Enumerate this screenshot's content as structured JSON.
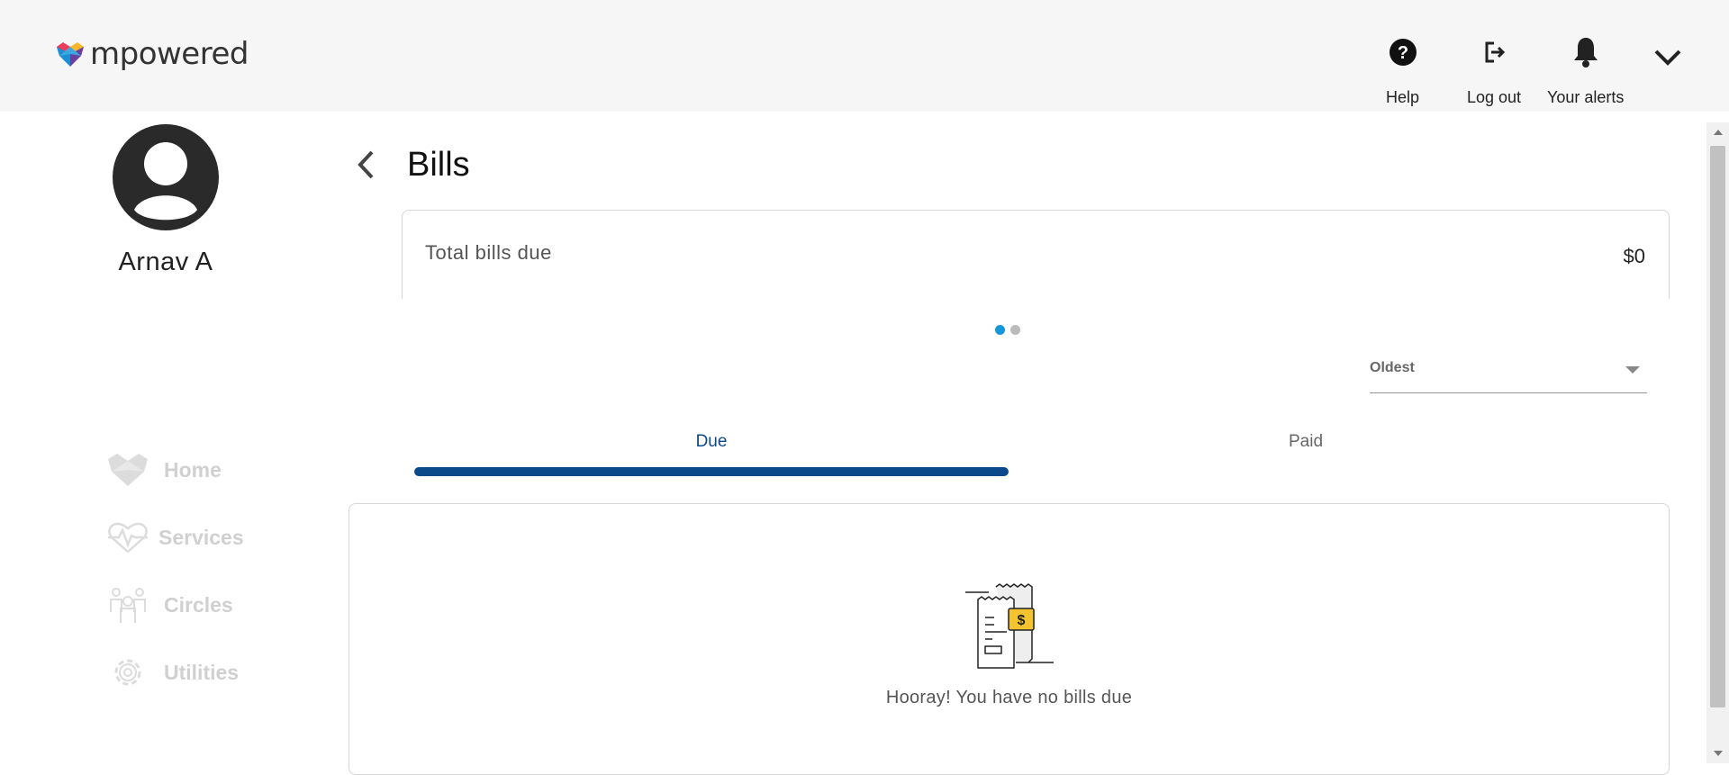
{
  "header": {
    "logo_text": "mpowered",
    "help_label": "Help",
    "logout_label": "Log out",
    "alerts_label": "Your alerts",
    "menu_icon": "chevron-down-icon"
  },
  "sidebar": {
    "user_name": "Arnav A",
    "items": [
      {
        "label": "Home",
        "icon": "home-heart-icon"
      },
      {
        "label": "Services",
        "icon": "heartbeat-icon"
      },
      {
        "label": "Circles",
        "icon": "people-icon"
      },
      {
        "label": "Utilities",
        "icon": "gear-icon"
      }
    ]
  },
  "main": {
    "title": "Bills",
    "total_card": {
      "label": "Total bills due",
      "value": "$0"
    },
    "sort": {
      "selected": "Oldest"
    },
    "tabs": [
      {
        "label": "Due",
        "active": true
      },
      {
        "label": "Paid",
        "active": false
      }
    ],
    "empty_message": "Hooray! You have no bills due"
  },
  "colors": {
    "accent": "#0a4a8a",
    "dot_active": "#1596d8",
    "nav_inactive": "#d0d0d0",
    "header_bg": "#f6f6f6"
  }
}
